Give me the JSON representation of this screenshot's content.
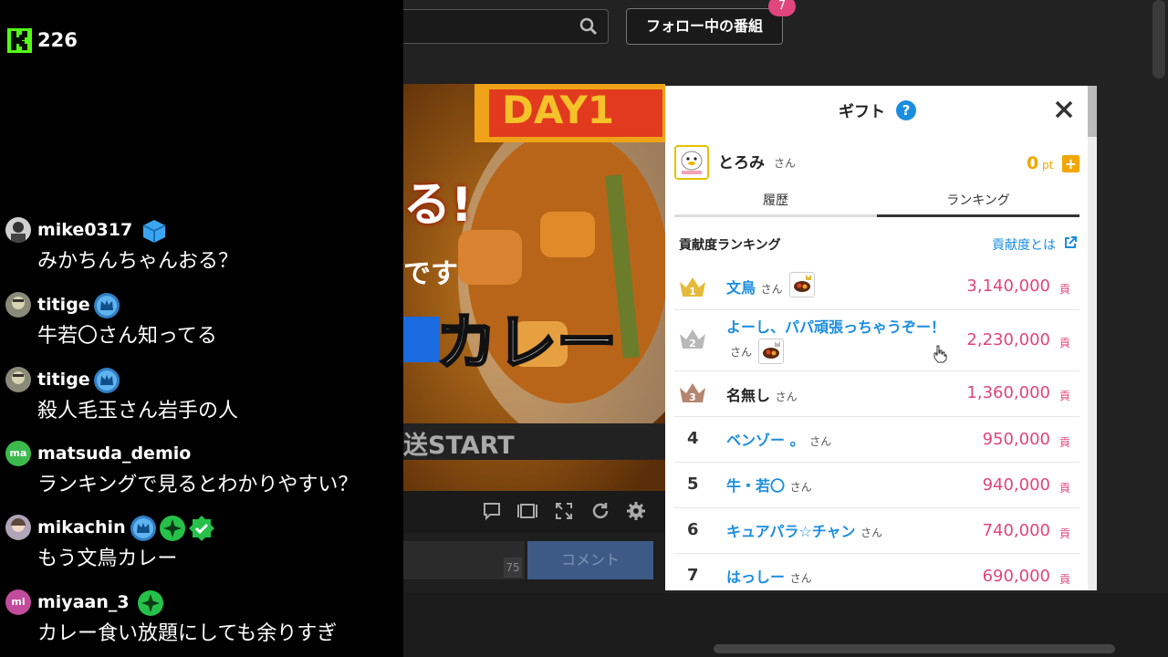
{
  "overlay": {
    "viewer_count": "226",
    "messages": [
      {
        "user": "mike0317",
        "text": "みかちんちゃんおる？",
        "avatar_color": "#cfcfcf",
        "badges": [
          "cube-badge-icon"
        ]
      },
      {
        "user": "titige",
        "text": "牛若〇さん知ってる",
        "avatar_color": "#8a8a7a",
        "badges": [
          "crown-badge-icon"
        ]
      },
      {
        "user": "titige",
        "text": "殺人毛玉さん岩手の人",
        "avatar_color": "#8a8a7a",
        "badges": [
          "crown-badge-icon"
        ]
      },
      {
        "user": "matsuda_demio",
        "text": "ランキングで見るとわかりやすい？",
        "avatar_text": "ma",
        "avatar_color": "#3dba4e",
        "badges": []
      },
      {
        "user": "mikachin",
        "text": "もう文鳥カレー",
        "avatar_color": "#b0a4b8",
        "badges": [
          "crown-badge-icon",
          "sparkle-badge-icon",
          "verified-badge-icon"
        ]
      },
      {
        "user": "miyaan_3",
        "text": "カレー食い放題にしても余りすぎ",
        "avatar_text": "mi",
        "avatar_color": "#c24b9b",
        "badges": [
          "sparkle-badge-icon"
        ]
      }
    ]
  },
  "header": {
    "follow_label": "フォロー中の番組",
    "follow_count": "7"
  },
  "video": {
    "day_label": "DAY1",
    "overlay_text_1": "る!",
    "overlay_text_2": "です",
    "overlay_text_3": "カレー",
    "overlay_text_4": "送START"
  },
  "comment": {
    "char_count": "75",
    "submit_label": "コメント"
  },
  "gift": {
    "title": "ギフト",
    "help": "?",
    "me": {
      "name": "とろみ",
      "san": "さん",
      "points": "0",
      "points_unit": "pt"
    },
    "tabs": [
      "履歴",
      "ランキング"
    ],
    "ranking_heading": "貢献度ランキング",
    "ranking_link": "貢献度とは",
    "san": "さん",
    "unit": "貢",
    "ranks": [
      {
        "rank": "1",
        "name": "文鳥",
        "points": "3,140,000"
      },
      {
        "rank": "2",
        "name": "よーし、パパ頑張っちゃうぞー！",
        "points": "2,230,000"
      },
      {
        "rank": "3",
        "name": "名無し",
        "points": "1,360,000"
      },
      {
        "rank": "4",
        "name": "ベンゾー 。",
        "points": "950,000"
      },
      {
        "rank": "5",
        "name": "牛・若〇",
        "points": "940,000"
      },
      {
        "rank": "6",
        "name": "キュアパラ☆チャン",
        "points": "740,000"
      },
      {
        "rank": "7",
        "name": "はっしー",
        "points": "690,000"
      }
    ],
    "colors": {
      "gold": "#e5b93a",
      "silver": "#b9b9b9",
      "bronze": "#b58570",
      "pink": "#e0457b",
      "blue": "#1a8de0"
    }
  }
}
